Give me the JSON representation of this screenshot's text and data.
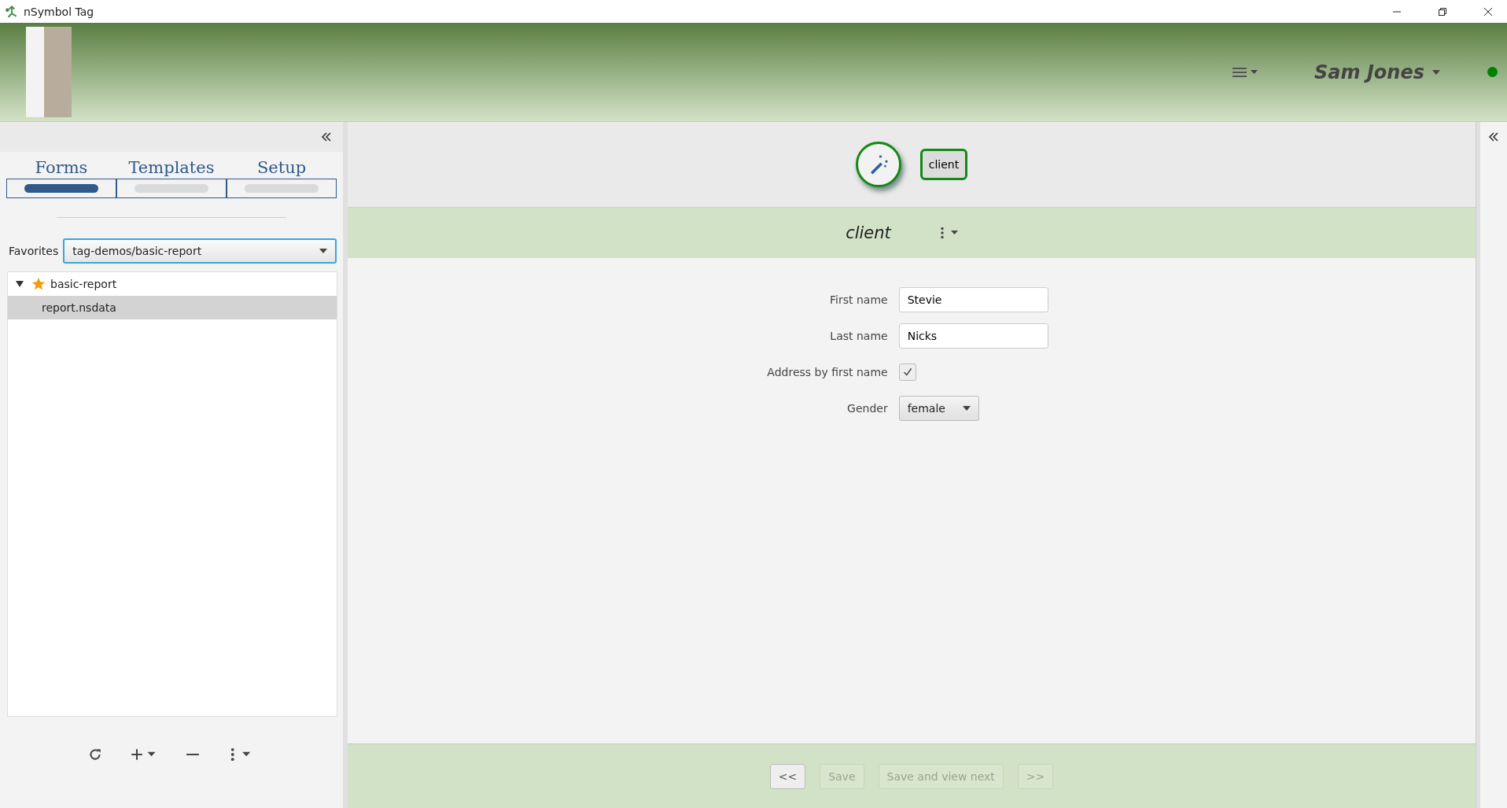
{
  "window": {
    "title": "nSymbol Tag"
  },
  "header": {
    "user": "Sam Jones",
    "online": true
  },
  "sidebar": {
    "tabs": [
      {
        "label": "Forms",
        "selected": true
      },
      {
        "label": "Templates",
        "selected": false
      },
      {
        "label": "Setup",
        "selected": false
      }
    ],
    "favorites": {
      "label": "Favorites",
      "value": "tag-demos/basic-report"
    },
    "tree": [
      {
        "label": "basic-report",
        "starred": true,
        "expanded": true,
        "selected": false,
        "children": [
          {
            "label": "report.nsdata",
            "selected": true
          }
        ]
      }
    ]
  },
  "main": {
    "breadcrumb": "client",
    "section_title": "client",
    "fields": [
      {
        "kind": "text",
        "label": "First name",
        "value": "Stevie"
      },
      {
        "kind": "text",
        "label": "Last name",
        "value": "Nicks"
      },
      {
        "kind": "checkbox",
        "label": "Address by first name",
        "checked": true
      },
      {
        "kind": "select",
        "label": "Gender",
        "value": "female"
      }
    ],
    "nav_buttons": [
      {
        "label": "<<",
        "disabled": false
      },
      {
        "label": "Save",
        "disabled": true
      },
      {
        "label": "Save and view next",
        "disabled": true
      },
      {
        "label": ">>",
        "disabled": true
      }
    ]
  }
}
